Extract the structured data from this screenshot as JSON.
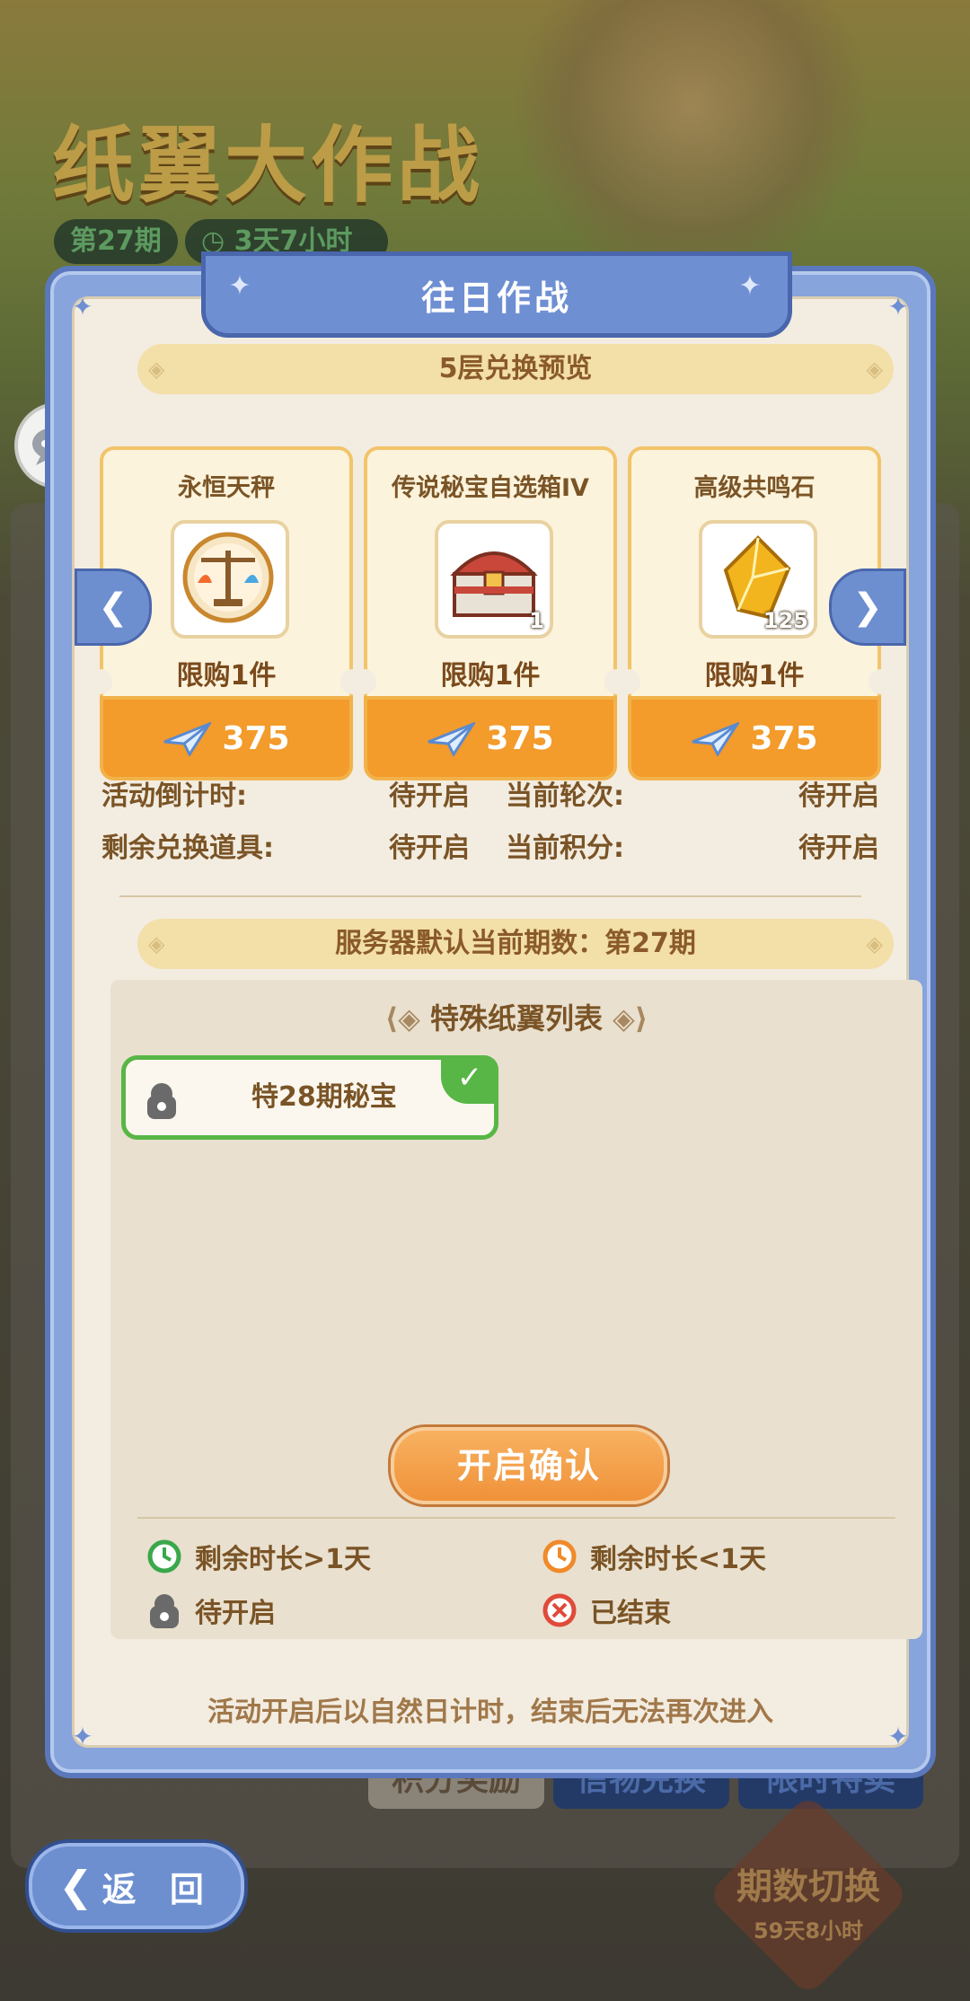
{
  "background": {
    "title": "纸翼大作战",
    "period_badge": "第27期",
    "time_badge": "3天7小时",
    "tabs": [
      "积分奖励",
      "信物兑换",
      "限时特卖"
    ],
    "switch_label": "期数切换",
    "switch_time": "59天8小时",
    "back_label": "返 回"
  },
  "dialog": {
    "title": "往日作战",
    "preview_band": "5层兑换预览",
    "cards": [
      {
        "name": "永恒天秤",
        "limit": "限购1件",
        "price": "375",
        "qty": "",
        "icon": "scales-icon"
      },
      {
        "name": "传说秘宝自选箱IV",
        "limit": "限购1件",
        "price": "375",
        "qty": "1",
        "icon": "treasure-chest-icon"
      },
      {
        "name": "高级共鸣石",
        "limit": "限购1件",
        "price": "375",
        "qty": "125",
        "icon": "yellow-gem-icon"
      }
    ],
    "info": {
      "countdown_label": "活动倒计时:",
      "countdown_value": "待开启",
      "round_label": "当前轮次:",
      "round_value": "待开启",
      "items_label": "剩余兑换道具:",
      "items_value": "待开启",
      "score_label": "当前积分:",
      "score_value": "待开启"
    },
    "server_band": "服务器默认当前期数：第27期",
    "special_title": "特殊纸翼列表",
    "special_items": [
      {
        "label": "特28期秘宝",
        "selected": true
      }
    ],
    "confirm_label": "开启确认",
    "legend": [
      {
        "label": "剩余时长>1天",
        "icon": "green-clock-icon"
      },
      {
        "label": "剩余时长<1天",
        "icon": "orange-clock-icon"
      },
      {
        "label": "待开启",
        "icon": "lock-icon"
      },
      {
        "label": "已结束",
        "icon": "red-x-icon"
      }
    ],
    "footer": "活动开启后以自然日计时，结束后无法再次进入"
  },
  "colors": {
    "accent_blue": "#6f8fd3",
    "orange": "#f39b2b",
    "green": "#58b646",
    "text_brown": "#7a5426"
  }
}
